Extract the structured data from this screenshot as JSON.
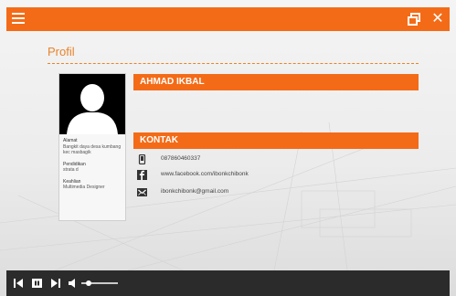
{
  "header": {
    "menu_icon": "hamburger-icon",
    "restore_icon": "window-restore-icon",
    "close_label": "✕"
  },
  "page": {
    "title": "Profil"
  },
  "profile": {
    "name": "AHMAD IKBAL",
    "address_label": "Alamat",
    "address_value": "Bangkit daya desa kumbang kec masbagik",
    "education_label": "Pendidikan",
    "education_value": "strata d",
    "skill_label": "Keahlian",
    "skill_value": "Multimedia Designer"
  },
  "contact": {
    "section_title": "KONTAK",
    "phone": "087860460337",
    "facebook": "www.facebook.com/ibonkchibonk",
    "email": "ibonkchibonk@gmail.com"
  },
  "player": {
    "icons": [
      "skip-back-icon",
      "pause-icon",
      "skip-forward-icon",
      "volume-icon",
      "volume-slider"
    ],
    "volume_level": 0.2
  },
  "colors": {
    "accent": "#f46b17",
    "title": "#e8842a",
    "player_bar": "#2b2b2b"
  }
}
